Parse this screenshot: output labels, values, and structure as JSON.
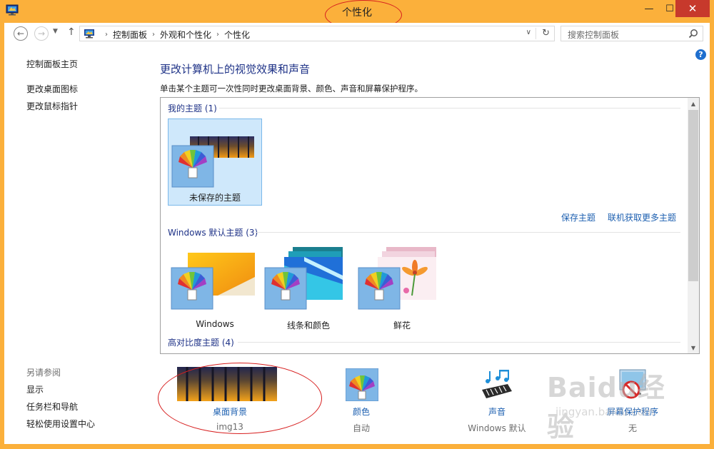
{
  "window": {
    "title": "个性化",
    "min_glyph": "—",
    "max_glyph": "☐",
    "close_glyph": "✕"
  },
  "nav": {
    "back_glyph": "←",
    "forward_glyph": "→",
    "dropdown_glyph": "▼",
    "up_glyph": "↑",
    "breadcrumbs": [
      "控制面板",
      "外观和个性化",
      "个性化"
    ],
    "separator": "›",
    "addr_dropdown_glyph": "∨",
    "refresh_glyph": "↻",
    "search_placeholder": "搜索控制面板"
  },
  "help_glyph": "?",
  "sidebar": {
    "home": "控制面板主页",
    "items": [
      "更改桌面图标",
      "更改鼠标指针"
    ],
    "see_also_title": "另请参阅",
    "see_also": [
      "显示",
      "任务栏和导航",
      "轻松使用设置中心"
    ]
  },
  "main": {
    "heading": "更改计算机上的视觉效果和声音",
    "description": "单击某个主题可一次性同时更改桌面背景、颜色、声音和屏幕保护程序。"
  },
  "themes": {
    "my_group_title": "我的主题 (1)",
    "my_themes": [
      {
        "name": "未保存的主题",
        "selected": true
      }
    ],
    "save_link": "保存主题",
    "more_link": "联机获取更多主题",
    "default_group_title": "Windows 默认主题 (3)",
    "default_themes": [
      {
        "name": "Windows"
      },
      {
        "name": "线条和颜色"
      },
      {
        "name": "鲜花"
      }
    ],
    "high_contrast_title": "高对比度主题 (4)",
    "scroll_up_glyph": "▲",
    "scroll_down_glyph": "▼"
  },
  "bottom": {
    "background_label": "桌面背景",
    "background_value": "img13",
    "color_label": "颜色",
    "color_value": "自动",
    "sound_label": "声音",
    "sound_value": "Windows 默认",
    "screensaver_label": "屏幕保护程序",
    "screensaver_value": "无"
  },
  "watermark": {
    "text": "Baidu经验",
    "sub": "jingyan.baidu.com"
  },
  "colors": {
    "frame": "#fbb03b",
    "close": "#c7392c",
    "link": "#1c5fb0",
    "heading": "#1e3287",
    "annotation": "#d71f1f"
  }
}
